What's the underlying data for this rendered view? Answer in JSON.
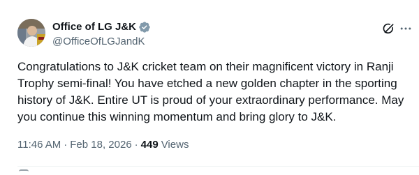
{
  "author": {
    "display_name": "Office of LG J&K",
    "handle": "@OfficeOfLGJandK",
    "verified_badge_color": "#829aab"
  },
  "post": {
    "text": "Congratulations to J&K cricket team on their magnificent victory in Ranji Trophy semi-final! You have etched a new golden chapter in the sporting history of J&K. Entire UT is proud of your extraordinary performance. May you continue this winning momentum and bring glory to J&K."
  },
  "meta": {
    "time": "11:46 AM",
    "separator": "·",
    "date": "Feb 18, 2026",
    "views_count": "449",
    "views_label": "Views"
  },
  "icons": {
    "avatar": "profile-photo",
    "badge": "verified-badge-icon",
    "grok": "grok-icon",
    "more": "more-options-icon"
  },
  "colors": {
    "text_primary": "#0f1419",
    "text_secondary": "#536471"
  }
}
